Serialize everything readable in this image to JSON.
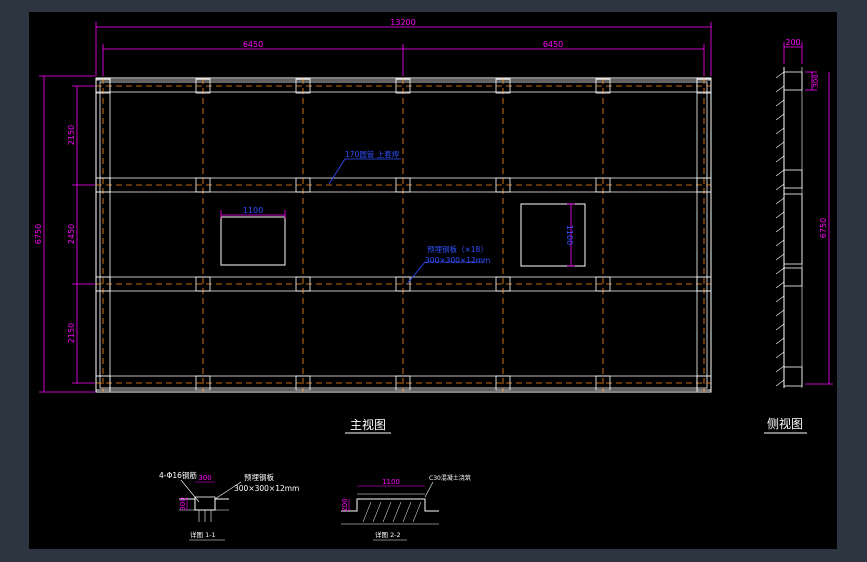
{
  "colors": {
    "frame": "#2d3640",
    "background": "#000000",
    "outline": "#ffffff",
    "dimension": "#ff00ff",
    "centerline": "#ff8c1a",
    "label": "#3050ff"
  },
  "front_view": {
    "title": "主视图",
    "overall_width": "13200",
    "half_left": "6450",
    "half_right": "6450",
    "overall_height": "6750",
    "bay_top": "2150",
    "bay_mid": "2450",
    "bay_bottom": "2150",
    "beam_note": "170圆管 上套焊",
    "plate_note_1": "预埋钢板（×18）",
    "plate_note_2": "300×300×12mm",
    "opening_width": "1100",
    "opening_height": "1100"
  },
  "side_view": {
    "title": "侧视图",
    "width_dim": "200",
    "small_dim": "300",
    "height_dim": "6750"
  },
  "section_1": {
    "title": "详图 1-1",
    "rebar_note": "4-Φ16钢筋",
    "width_dim": "300",
    "height_dim": "300",
    "plate_note_1": "预埋钢板",
    "plate_note_2": "300×300×12mm"
  },
  "section_2": {
    "title": "详图 2-2",
    "width_dim": "1100",
    "height_dim": "200",
    "note": "C30混凝土浇筑"
  }
}
